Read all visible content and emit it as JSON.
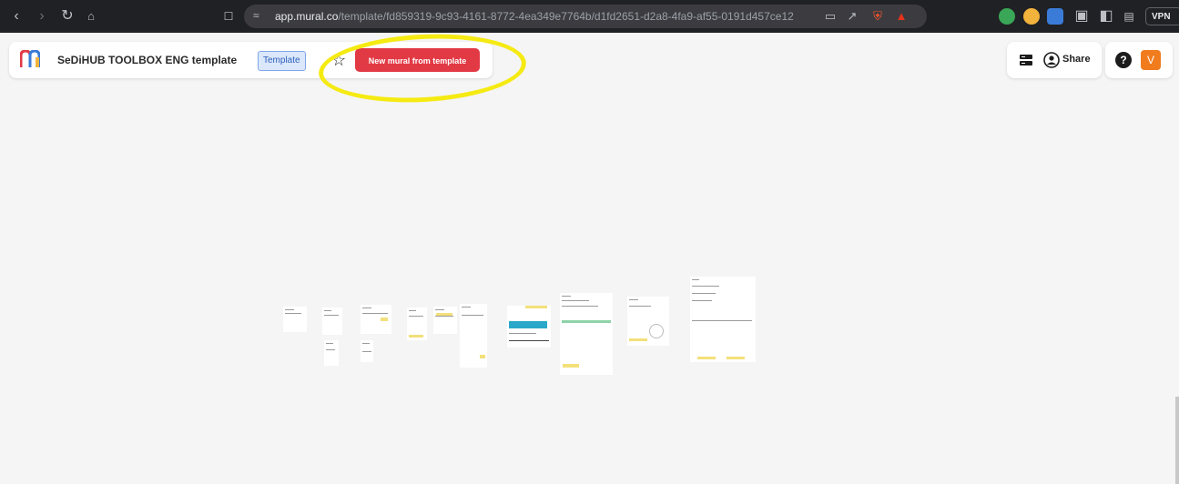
{
  "browser": {
    "url_host": "app.mural.co",
    "url_path": "/template/fd859319-9c93-4161-8772-4ea349e7764b/d1fd2651-d2a8-4fa9-af55-0191d457ce12",
    "vpn_label": "VPN",
    "icons": [
      "back-icon",
      "forward-icon",
      "reload-icon",
      "home-icon",
      "bookmark-icon",
      "site-settings-icon",
      "cast-icon",
      "share-page-icon",
      "brave-shields-icon",
      "brave-rewards-icon",
      "extension-icon",
      "extension-icon",
      "extension-icon",
      "puzzle-extensions-icon",
      "sidebar-icon",
      "wallet-icon"
    ]
  },
  "header": {
    "title": "SeDiHUB TOOLBOX ENG template",
    "tag": "Template",
    "new_mural_button": "New mural from template",
    "share_label": "Share",
    "help_label": "?",
    "avatar_initial": "V"
  },
  "colors": {
    "accent": "#e23a45",
    "highlight": "#f5ea12",
    "tag_bg": "#dbe7fb",
    "avatar": "#f07c1e"
  }
}
